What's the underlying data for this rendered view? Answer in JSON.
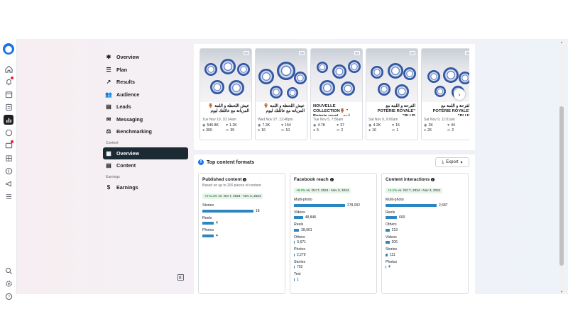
{
  "nav": {
    "items": [
      {
        "label": "Overview",
        "icon": "sparkle-icon"
      },
      {
        "label": "Plan",
        "icon": "plan-icon"
      },
      {
        "label": "Results",
        "icon": "trend-icon"
      },
      {
        "label": "Audience",
        "icon": "audience-icon"
      },
      {
        "label": "Leads",
        "icon": "leads-icon"
      },
      {
        "label": "Messaging",
        "icon": "messaging-icon"
      },
      {
        "label": "Benchmarking",
        "icon": "benchmark-icon"
      }
    ],
    "content_section": "Content",
    "content_items": [
      {
        "label": "Overview",
        "icon": "grid-icon",
        "selected": true
      },
      {
        "label": "Content",
        "icon": "table-icon",
        "selected": false
      }
    ],
    "earnings_section": "Earnings",
    "earnings_items": [
      {
        "label": "Earnings",
        "icon": "dollar-icon"
      }
    ]
  },
  "posts": [
    {
      "caption": "عيش اللحظة و اللمة 🏺المزيانة مع عائلتك ليوم",
      "date": "Tue Nov 19, 10:14am",
      "reach": "546.8K",
      "likes": "1.2K",
      "comments": "360",
      "shares": "35"
    },
    {
      "caption": "عيش اللحظة و اللمة 🏺المزيانة مع عائلتك ليوم",
      "date": "Wed Nov 27, 12:48pm",
      "reach": "7.3K",
      "likes": "154",
      "comments": "16",
      "shares": "10"
    },
    {
      "caption": "NOUVELLE COLLECTION🏺 \" Poterie royal... ليوم",
      "date": "Tue Nov 5, 7:56am",
      "reach": "4.7K",
      "likes": "37",
      "comments": "5",
      "shares": "2"
    },
    {
      "caption": "الفرحة و اللمة مع \"POTERIE ROYALE PLUS\"",
      "date": "Sat Nov 9, 9:00am",
      "reach": "4.2K",
      "likes": "15",
      "comments": "16",
      "shares": "1"
    },
    {
      "caption": "الفرحة و اللمة مع \"POTERIE ROYALE PLUS\"",
      "date": "Sat Nov 9, 11:01am",
      "reach": "2K",
      "likes": "44",
      "comments": "26",
      "shares": "2"
    }
  ],
  "formats": {
    "title": "Top content formats",
    "export_label": "Export",
    "cards": [
      {
        "title": "Published content",
        "subtitle": "Based on up to 200 pieces of content",
        "delta": "+271.4%",
        "delta_rest": " vs. Oct 7, 2024 - Nov 3, 2024",
        "rows": [
          {
            "label": "Stories",
            "value": 18,
            "display": "18"
          },
          {
            "label": "Reels",
            "value": 4,
            "display": "4"
          },
          {
            "label": "Photos",
            "value": 4,
            "display": "4"
          }
        ]
      },
      {
        "title": "Facebook reach",
        "subtitle": "",
        "delta": "+9.2%",
        "delta_rest": " vs. Oct 7, 2024 - Nov 3, 2024",
        "rows": [
          {
            "label": "Multi-photo",
            "value": 278002,
            "display": "278,002"
          },
          {
            "label": "Videos",
            "value": 48848,
            "display": "48,848"
          },
          {
            "label": "Reels",
            "value": 28061,
            "display": "28,061"
          },
          {
            "label": "Others",
            "value": 5671,
            "display": "5,671"
          },
          {
            "label": "Photos",
            "value": 2279,
            "display": "2,279"
          },
          {
            "label": "Stories",
            "value": 702,
            "display": "702"
          },
          {
            "label": "Text",
            "value": 1,
            "display": "1"
          }
        ]
      },
      {
        "title": "Content interactions",
        "subtitle": "",
        "delta": "+2.1%",
        "delta_rest": " vs. Oct 7, 2024 - Nov 3, 2024",
        "rows": [
          {
            "label": "Multi-photo",
            "value": 2687,
            "display": "2,687"
          },
          {
            "label": "Reels",
            "value": 600,
            "display": "600"
          },
          {
            "label": "Others",
            "value": 213,
            "display": "213"
          },
          {
            "label": "Videos",
            "value": 206,
            "display": "206"
          },
          {
            "label": "Stories",
            "value": 111,
            "display": "111"
          },
          {
            "label": "Photos",
            "value": 4,
            "display": "4"
          }
        ]
      }
    ]
  },
  "colors": {
    "bar": "#2e86c1",
    "accent": "#1877f2",
    "selected_nav": "#1c2b33",
    "positive": "#31a24c"
  }
}
